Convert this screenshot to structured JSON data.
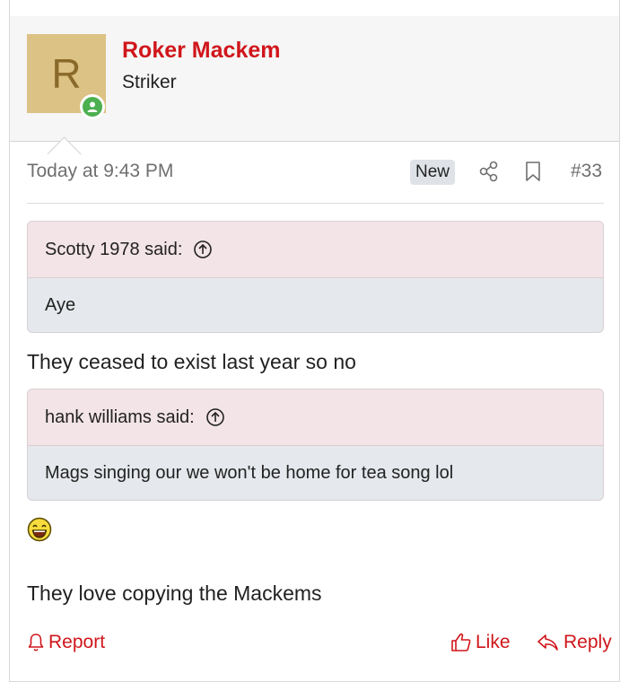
{
  "post": {
    "author": {
      "avatar_letter": "R",
      "name": "Roker Mackem",
      "title": "Striker",
      "online": true
    },
    "meta": {
      "time": "Today at 9:43 PM",
      "badge": "New",
      "number": "#33"
    },
    "quotes": [
      {
        "header": "Scotty 1978 said:",
        "body": "Aye"
      },
      {
        "header": "hank williams said:",
        "body": "Mags singing our we won't be home for tea song lol"
      }
    ],
    "messages": [
      "They ceased to exist last year so no",
      "They love copying the Mackems"
    ],
    "actions": {
      "report": "Report",
      "like": "Like",
      "reply": "Reply"
    }
  },
  "colors": {
    "accent": "#d0161b",
    "topbar": "#e40c0c",
    "quote_header_bg": "#f3e4e7",
    "quote_body_bg": "#e5e8ec",
    "avatar_bg": "#dcc285",
    "online": "#4caf50"
  },
  "icons": {
    "online": "user-online-icon",
    "share": "share-icon",
    "bookmark": "bookmark-icon",
    "quote_jump": "arrow-up-circle-icon",
    "smiley": "laughing-smiley-icon",
    "report": "bell-icon",
    "like": "thumbs-up-icon",
    "reply": "reply-arrow-icon"
  }
}
